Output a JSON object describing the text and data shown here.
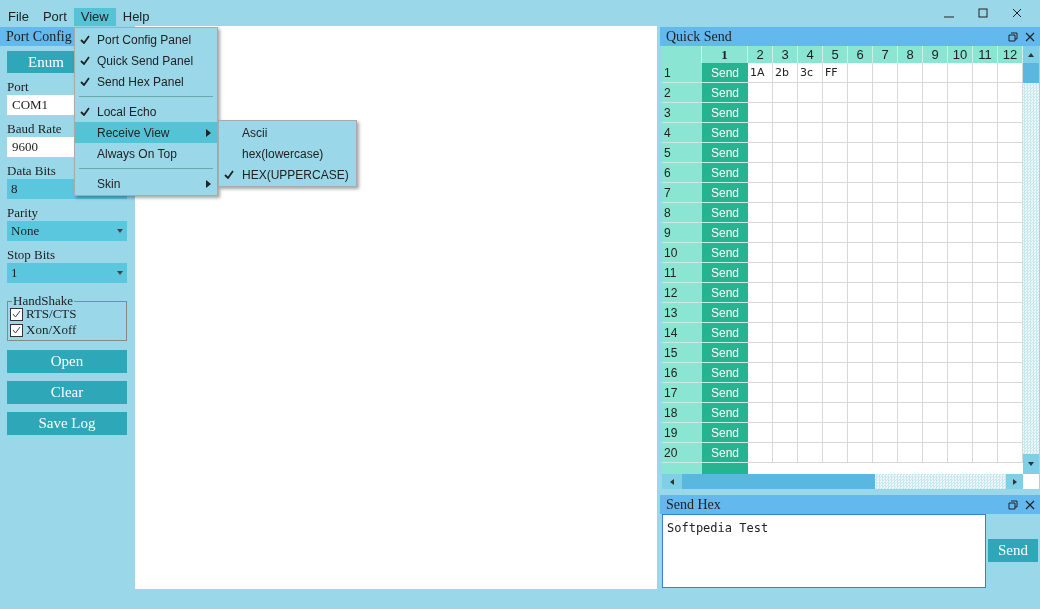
{
  "menu_bar": [
    {
      "label": "File",
      "selected": false
    },
    {
      "label": "Port",
      "selected": false
    },
    {
      "label": "View",
      "selected": true
    },
    {
      "label": "Help",
      "selected": false
    }
  ],
  "view_menu": [
    {
      "kind": "item",
      "label": "Port Config Panel",
      "checked": true,
      "highlighted": false
    },
    {
      "kind": "item",
      "label": "Quick Send Panel",
      "checked": true,
      "highlighted": false
    },
    {
      "kind": "item",
      "label": "Send Hex Panel",
      "checked": true,
      "highlighted": false
    },
    {
      "kind": "separator"
    },
    {
      "kind": "item",
      "label": "Local Echo",
      "checked": true,
      "highlighted": false
    },
    {
      "kind": "submenu",
      "label": "Receive View",
      "checked": false,
      "highlighted": true
    },
    {
      "kind": "item",
      "label": "Always On Top",
      "checked": false,
      "highlighted": false
    },
    {
      "kind": "separator"
    },
    {
      "kind": "submenu",
      "label": "Skin",
      "checked": false,
      "highlighted": false
    }
  ],
  "receive_view_menu": [
    {
      "label": "Ascii",
      "checked": false
    },
    {
      "label": "hex(lowercase)",
      "checked": false
    },
    {
      "label": "HEX(UPPERCASE)",
      "checked": true
    }
  ],
  "port_config": {
    "title": "Port Config",
    "enum_button": "Enum",
    "fields": [
      {
        "label": "Port",
        "value": "COM1",
        "kind": "text"
      },
      {
        "label": "Baud Rate",
        "value": "9600",
        "kind": "text"
      },
      {
        "label": "Data Bits",
        "value": "8",
        "kind": "select"
      },
      {
        "label": "Parity",
        "value": "None",
        "kind": "select"
      },
      {
        "label": "Stop Bits",
        "value": "1",
        "kind": "select"
      }
    ],
    "handshake": {
      "title": "HandShake",
      "options": [
        {
          "label": "RTS/CTS",
          "checked": true
        },
        {
          "label": "Xon/Xoff",
          "checked": true
        }
      ]
    },
    "buttons": [
      "Open",
      "Clear",
      "Save Log"
    ]
  },
  "quick_send": {
    "title": "Quick Send",
    "columns": [
      "1",
      "2",
      "3",
      "4",
      "5",
      "6",
      "7",
      "8",
      "9",
      "10",
      "11",
      "12"
    ],
    "rows": [
      {
        "label": "1",
        "button": "Send",
        "cells": [
          "1A",
          "2b",
          "3c",
          "FF"
        ]
      },
      {
        "label": "2",
        "button": "Send"
      },
      {
        "label": "3",
        "button": "Send"
      },
      {
        "label": "4",
        "button": "Send"
      },
      {
        "label": "5",
        "button": "Send"
      },
      {
        "label": "6",
        "button": "Send"
      },
      {
        "label": "7",
        "button": "Send"
      },
      {
        "label": "8",
        "button": "Send"
      },
      {
        "label": "9",
        "button": "Send"
      },
      {
        "label": "10",
        "button": "Send"
      },
      {
        "label": "11",
        "button": "Send"
      },
      {
        "label": "12",
        "button": "Send"
      },
      {
        "label": "13",
        "button": "Send"
      },
      {
        "label": "14",
        "button": "Send"
      },
      {
        "label": "15",
        "button": "Send"
      },
      {
        "label": "16",
        "button": "Send"
      },
      {
        "label": "17",
        "button": "Send"
      },
      {
        "label": "18",
        "button": "Send"
      },
      {
        "label": "19",
        "button": "Send"
      },
      {
        "label": "20",
        "button": "Send"
      }
    ]
  },
  "send_hex": {
    "title": "Send Hex",
    "value": "Softpedia Test",
    "button": "Send"
  }
}
